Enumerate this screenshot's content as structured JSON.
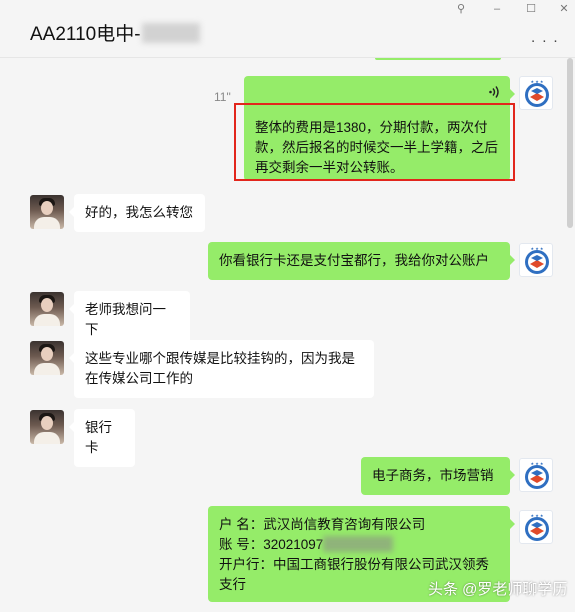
{
  "window": {
    "title": "AA2110电中-",
    "controls": {
      "pin": "⚲",
      "minimize": "–",
      "maximize": "☐",
      "close": "✕"
    },
    "more_label": "· · ·"
  },
  "conversation": {
    "voice_message": {
      "duration": "11\"",
      "transcript": "整体的费用是1380，分期付款，两次付款，然后报名的时候交一半上学籍，之后再交剩余一半对公转账。"
    },
    "messages": [
      {
        "sender": "other",
        "text": "好的，我怎么转您"
      },
      {
        "sender": "self",
        "text": "你看银行卡还是支付宝都行，我给你对公账户"
      },
      {
        "sender": "other",
        "text": "老师我想问一下"
      },
      {
        "sender": "other",
        "text": "这些专业哪个跟传媒是比较挂钩的，因为我是在传媒公司工作的"
      },
      {
        "sender": "other",
        "text": "银行卡"
      },
      {
        "sender": "self",
        "text": "电子商务，市场营销"
      }
    ],
    "account_message": {
      "name_line": "户  名：武汉尚信教育咨询有限公司",
      "account_line": "账  号：32021097",
      "bank_line": "开户行：中国工商银行股份有限公司武汉领秀支行"
    }
  },
  "watermark": "头条 @罗老师聊学历",
  "colors": {
    "self_bubble": "#95ec69",
    "other_bubble": "#ffffff",
    "background": "#f5f5f5",
    "highlight_border": "#e2261c"
  }
}
